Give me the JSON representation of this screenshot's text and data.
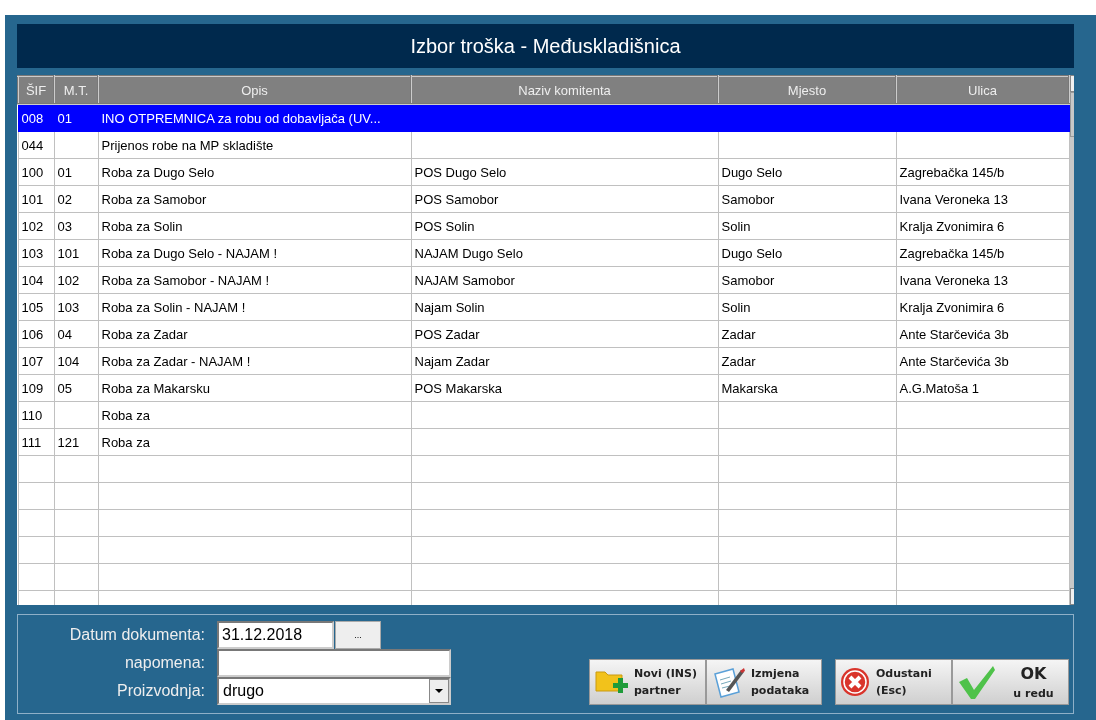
{
  "dialog": {
    "title": "Izbor troška - Međuskladišnica"
  },
  "table": {
    "columns": [
      "ŠIF",
      "M.T.",
      "Opis",
      "Naziv komitenta",
      "Mjesto",
      "Ulica"
    ],
    "rows": [
      {
        "cells": [
          "008",
          "01",
          "INO OTPREMNICA za robu od dobavljača (UV...",
          "",
          "",
          ""
        ],
        "selected": true
      },
      {
        "cells": [
          "044",
          "",
          "Prijenos robe na MP skladište",
          "",
          "",
          ""
        ],
        "selected": false
      },
      {
        "cells": [
          "100",
          "01",
          "Roba za Dugo Selo",
          "POS Dugo Selo",
          "Dugo Selo",
          "Zagrebačka 145/b"
        ],
        "selected": false
      },
      {
        "cells": [
          "101",
          "02",
          "Roba za Samobor",
          "POS Samobor",
          "Samobor",
          "Ivana Veroneka 13"
        ],
        "selected": false
      },
      {
        "cells": [
          "102",
          "03",
          "Roba za Solin",
          "POS Solin",
          "Solin",
          "Kralja Zvonimira 6"
        ],
        "selected": false
      },
      {
        "cells": [
          "103",
          "101",
          "Roba za Dugo Selo - NAJAM !",
          "NAJAM Dugo Selo",
          "Dugo Selo",
          "Zagrebačka 145/b"
        ],
        "selected": false
      },
      {
        "cells": [
          "104",
          "102",
          "Roba za Samobor - NAJAM !",
          "NAJAM Samobor",
          "Samobor",
          "Ivana Veroneka 13"
        ],
        "selected": false
      },
      {
        "cells": [
          "105",
          "103",
          "Roba za Solin - NAJAM !",
          "Najam Solin",
          "Solin",
          "Kralja Zvonimira 6"
        ],
        "selected": false
      },
      {
        "cells": [
          "106",
          "04",
          "Roba za Zadar",
          "POS Zadar",
          "Zadar",
          "Ante Starčevića 3b"
        ],
        "selected": false
      },
      {
        "cells": [
          "107",
          "104",
          "Roba za Zadar - NAJAM !",
          "Najam Zadar",
          "Zadar",
          "Ante Starčevića 3b"
        ],
        "selected": false
      },
      {
        "cells": [
          "109",
          "05",
          "Roba za Makarsku",
          "POS Makarska",
          "Makarska",
          "A.G.Matoša 1"
        ],
        "selected": false
      },
      {
        "cells": [
          "110",
          "",
          "Roba za",
          "",
          "",
          ""
        ],
        "selected": false
      },
      {
        "cells": [
          "111",
          "121",
          "Roba za",
          "",
          "",
          ""
        ],
        "selected": false
      }
    ]
  },
  "form": {
    "date_label": "Datum dokumenta:",
    "date_value": "31.12.2018",
    "date_button": "...",
    "note_label": "napomena:",
    "production_label": "Proizvodnja:",
    "production_value": "drugo"
  },
  "buttons": [
    {
      "kind": "new",
      "lines": [
        "Novi",
        "partner"
      ],
      "hint": "(INS)"
    },
    {
      "kind": "edit",
      "lines": [
        "Izmjena",
        "podataka"
      ]
    },
    {
      "kind": "cancel",
      "lines": [
        "Odustani",
        "(Esc)"
      ]
    },
    {
      "kind": "ok",
      "lines": [
        "OK",
        "u redu"
      ]
    }
  ]
}
